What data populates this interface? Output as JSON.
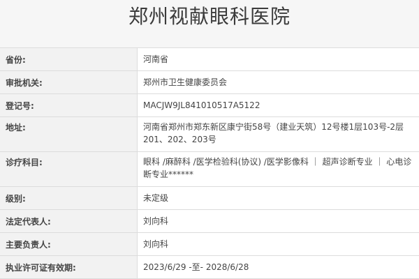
{
  "title": "郑州视献眼科医院",
  "rows": [
    {
      "label": "省份:",
      "value": "河南省"
    },
    {
      "label": "审批机关:",
      "value": "郑州市卫生健康委员会"
    },
    {
      "label": "登记号:",
      "value": "MACJW9JL841010517A5122"
    },
    {
      "label": "地址:",
      "value": "河南省郑州市郑东新区康宁街58号（建业天筑）12号楼1层103号-2层201、202、203号"
    },
    {
      "label": "诊疗科目:",
      "value": "眼科 /麻醉科 /医学检验科(协议) /医学影像科 ｜ 超声诊断专业 ｜ 心电诊断专业******"
    },
    {
      "label": "级别:",
      "value": "未定级"
    },
    {
      "label": "法定代表人:",
      "value": "刘向科"
    },
    {
      "label": "主要负责人:",
      "value": "刘向科"
    },
    {
      "label": "执业许可证有效期:",
      "value": "2023/6/29 -至- 2028/6/28"
    }
  ]
}
